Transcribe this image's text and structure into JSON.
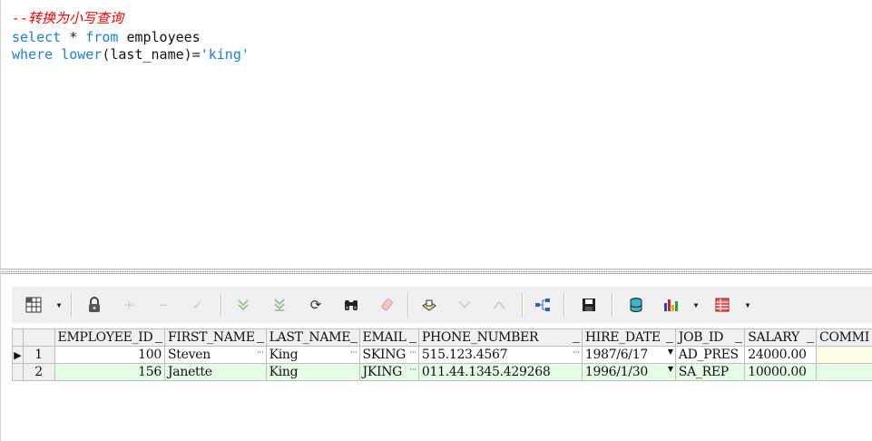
{
  "editor": {
    "comment": "--转换为小写查询",
    "line2": {
      "kw_select": "select",
      "star": "*",
      "kw_from": "from",
      "table": "employees"
    },
    "line3": {
      "kw_where": "where",
      "fn_lower": "lower",
      "open": "(",
      "column": "last_name",
      "close_eq": ")=",
      "literal": "'king'"
    }
  },
  "toolbar": {
    "icons": [
      "grid-select-icon",
      "lock-icon",
      "plus-icon",
      "minus-icon",
      "check-icon",
      "fetch-next-icon",
      "fetch-last-icon",
      "refresh-icon",
      "binoculars-icon",
      "clear-icon",
      "print-icon",
      "filter-down-icon",
      "filter-up-icon",
      "tree-icon",
      "save-icon",
      "database-icon",
      "chart-icon",
      "table-grid-icon"
    ]
  },
  "grid": {
    "columns": [
      "EMPLOYEE_ID",
      "FIRST_NAME",
      "LAST_NAME",
      "EMAIL",
      "PHONE_NUMBER",
      "HIRE_DATE",
      "JOB_ID",
      "SALARY",
      "COMMI"
    ],
    "rows": [
      {
        "num": "1",
        "indicator": "▶",
        "EMPLOYEE_ID": "100",
        "FIRST_NAME": "Steven",
        "LAST_NAME": "King",
        "EMAIL": "SKING",
        "PHONE_NUMBER": "515.123.4567",
        "HIRE_DATE": "1987/6/17",
        "JOB_ID": "AD_PRES",
        "SALARY": "24000.00"
      },
      {
        "num": "2",
        "indicator": "",
        "EMPLOYEE_ID": "156",
        "FIRST_NAME": "Janette",
        "LAST_NAME": "King",
        "EMAIL": "JKING",
        "PHONE_NUMBER": "011.44.1345.429268",
        "HIRE_DATE": "1996/1/30",
        "JOB_ID": "SA_REP",
        "SALARY": "10000.00"
      }
    ]
  },
  "colors": {
    "keyword": "#1b7fd4",
    "comment": "#ff0000",
    "row_selected_fill": "#fffde6",
    "row_alt": "#e6fbe6"
  }
}
